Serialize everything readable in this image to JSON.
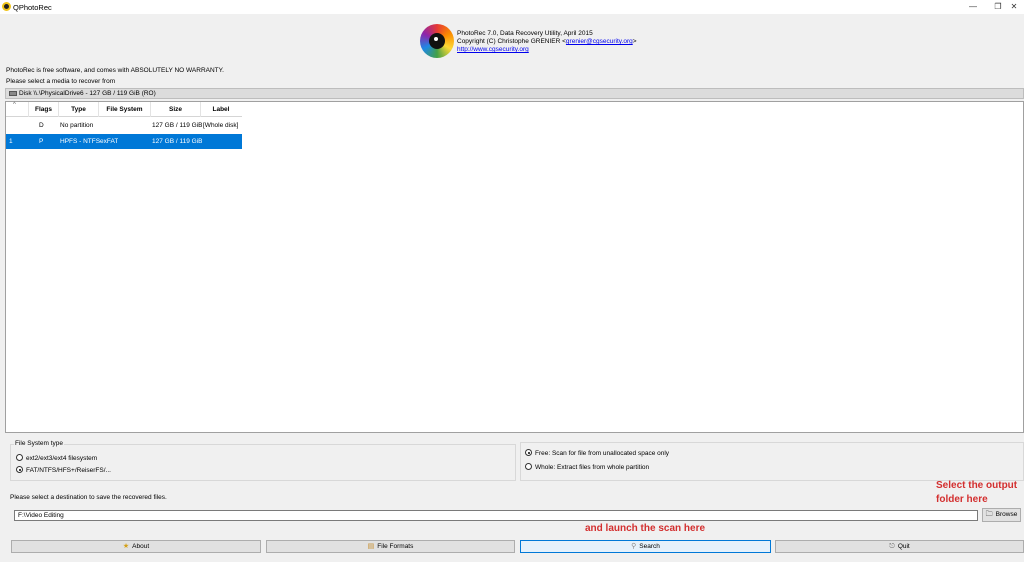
{
  "window": {
    "title": "QPhotoRec",
    "minimize": "—",
    "restore": "❐",
    "close": "✕"
  },
  "header": {
    "line1": "PhotoRec 7.0, Data Recovery Utility, April 2015",
    "line2_prefix": "Copyright (C) Christophe GRENIER <",
    "email": "grenier@cgsecurity.org",
    "line2_suffix": ">",
    "url": "http://www.cgsecurity.org"
  },
  "warranty_text": "PhotoRec is free software, and comes with ABSOLUTELY NO WARRANTY.",
  "select_media_text": "Please select a media to recover from",
  "disk": {
    "label": "Disk \\\\.\\PhysicalDrive6 - 127 GB / 119 GiB (RO)"
  },
  "table": {
    "sort_indicator": "^",
    "columns": [
      "",
      "Flags",
      "Type",
      "File System",
      "Size",
      "Label"
    ],
    "rows": [
      {
        "num": "",
        "flags": "D",
        "type": "No partition",
        "fs": "",
        "size": "127 GB / 119 GiB",
        "label": "[Whole disk]",
        "selected": false
      },
      {
        "num": "1",
        "flags": "P",
        "type": "HPFS - NTFS",
        "fs": "exFAT",
        "size": "127 GB / 119 GiB",
        "label": "",
        "selected": true
      }
    ]
  },
  "fs_type": {
    "title": "File System type",
    "options": [
      {
        "label": "ext2/ext3/ext4 filesystem",
        "selected": false
      },
      {
        "label": "FAT/NTFS/HFS+/ReiserFS/...",
        "selected": true
      }
    ]
  },
  "scan_mode": {
    "options": [
      {
        "label": "Free: Scan for file from unallocated space only",
        "selected": true
      },
      {
        "label": "Whole: Extract files from whole partition",
        "selected": false
      }
    ]
  },
  "destination": {
    "label": "Please select a destination to save the recovered files.",
    "value": "F:\\Video Editing",
    "browse_label": "Browse"
  },
  "annotations": {
    "output_line1": "Select the output",
    "output_line2": "folder here",
    "scan": "and launch the scan here"
  },
  "buttons": {
    "about": "About",
    "file_formats": "File Formats",
    "search": "Search",
    "quit": "Quit"
  },
  "icons": {
    "about": "star-icon",
    "file_formats": "folder-icon",
    "search": "search-icon",
    "quit": "quit-icon",
    "disk": "disk-drive-icon",
    "browse": "folder-open-icon"
  },
  "colors": {
    "selection": "#0078d7",
    "annotation": "#d32f2f",
    "link": "#0000ee"
  }
}
